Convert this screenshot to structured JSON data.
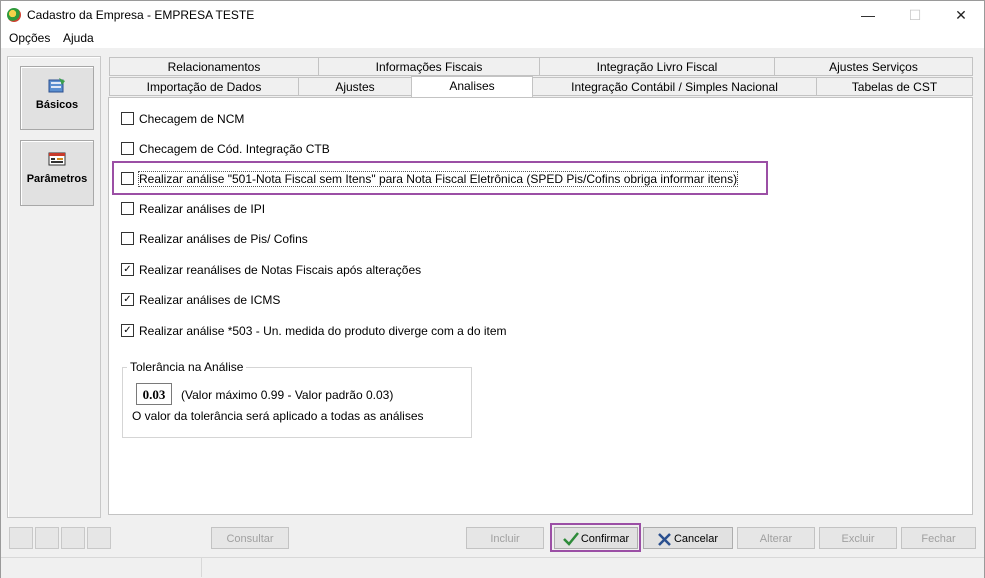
{
  "window": {
    "title": "Cadastro da Empresa - EMPRESA TESTE",
    "minimize": "—",
    "maximize": "☐",
    "close": "✕"
  },
  "menu": [
    "Opções",
    "Ajuda"
  ],
  "sidebar": {
    "items": [
      {
        "label": "Básicos",
        "icon": "basic-data-icon"
      },
      {
        "label": "Parâmetros",
        "icon": "parameters-icon"
      }
    ]
  },
  "tabs": {
    "row1": [
      "Relacionamentos",
      "Informações Fiscais",
      "Integração Livro Fiscal",
      "Ajustes Serviços"
    ],
    "row2": [
      "Importação de Dados",
      "Ajustes",
      "Analises",
      "Integração Contábil / Simples Nacional",
      "Tabelas de CST"
    ],
    "active": "Analises"
  },
  "checks": [
    {
      "label": "Checagem de NCM",
      "checked": false
    },
    {
      "label": "Checagem de Cód. Integração CTB",
      "checked": false
    },
    {
      "label": "Realizar análise \"501-Nota Fiscal sem Itens\" para Nota Fiscal Eletrônica (SPED Pis/Cofins obriga informar itens)",
      "checked": false
    },
    {
      "label": "Realizar análises de IPI",
      "checked": false
    },
    {
      "label": "Realizar análises de Pis/ Cofins",
      "checked": false
    },
    {
      "label": "Realizar reanálises de Notas Fiscais após alterações",
      "checked": true
    },
    {
      "label": "Realizar análises de ICMS",
      "checked": true
    },
    {
      "label": "Realizar análise *503 - Un. medida do produto diverge com a do item",
      "checked": true
    }
  ],
  "tolerance": {
    "title": "Tolerância na Análise",
    "value": "0.03",
    "hint": "(Valor máximo 0.99 - Valor padrão 0.03)",
    "note": "O valor da tolerância será aplicado a todas as análises"
  },
  "buttons": {
    "consultar": "Consultar",
    "incluir": "Incluir",
    "confirmar": "Confirmar",
    "cancelar": "Cancelar",
    "alterar": "Alterar",
    "excluir": "Excluir",
    "fechar": "Fechar"
  },
  "colors": {
    "highlight": "#9b4fa5",
    "confirm_check": "#2e8b3a",
    "cancel_x": "#2a4f8f"
  }
}
